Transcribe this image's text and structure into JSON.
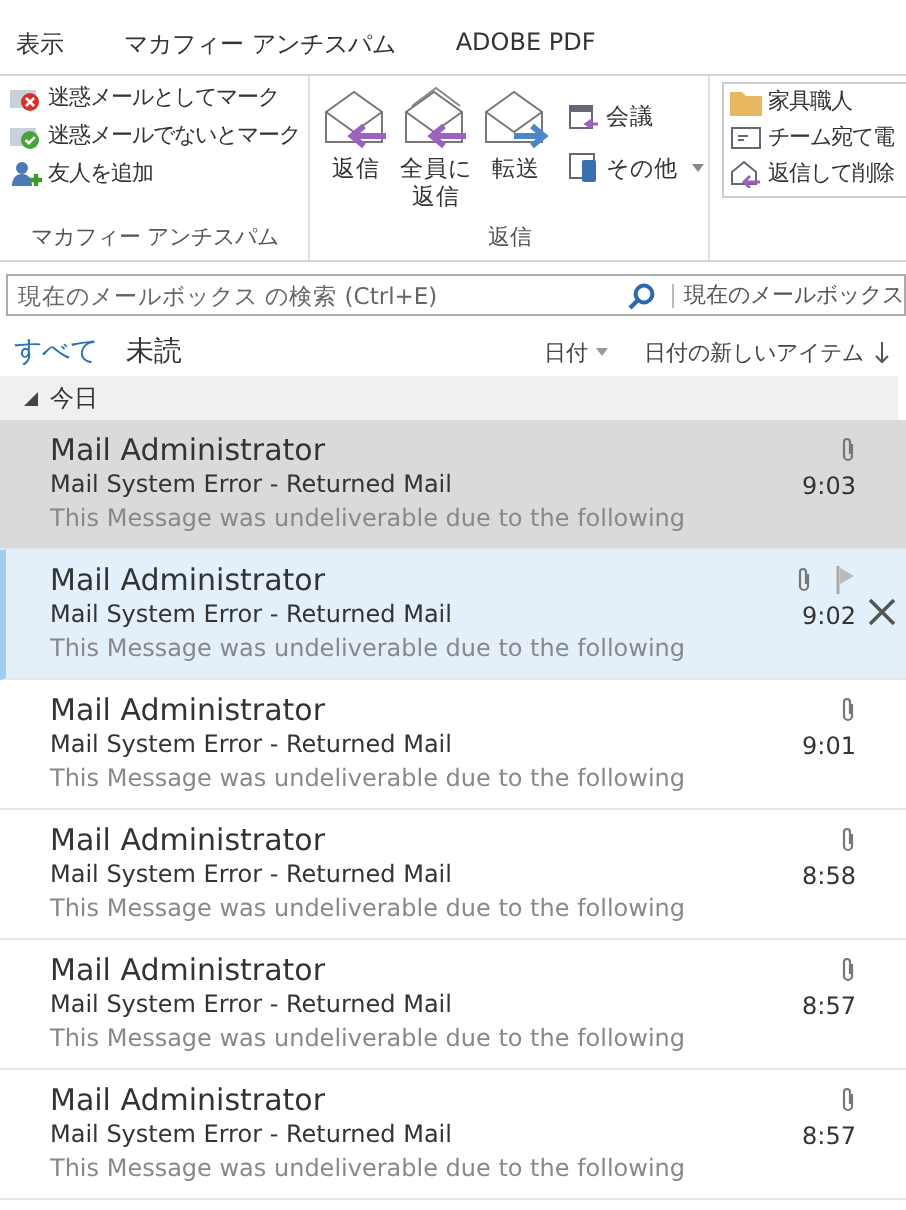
{
  "ribbon_tabs": [
    {
      "label": "表示"
    },
    {
      "label": "マカフィー アンチスパム"
    },
    {
      "label": "ADOBE PDF"
    }
  ],
  "ribbon": {
    "groups": [
      {
        "label": "マカフィー アンチスパム",
        "items": [
          {
            "kind": "spam",
            "label": "迷惑メールとしてマーク"
          },
          {
            "kind": "notspam",
            "label": "迷惑メールでないとマーク"
          },
          {
            "kind": "friend",
            "label": "友人を追加"
          }
        ]
      },
      {
        "label": "返信",
        "big": [
          {
            "kind": "reply",
            "label": "返信"
          },
          {
            "kind": "replyall",
            "label": "全員に返信"
          },
          {
            "kind": "forward",
            "label": "転送"
          }
        ],
        "small": [
          {
            "kind": "meeting",
            "label": "会議",
            "dropdown": false
          },
          {
            "kind": "more",
            "label": "その他",
            "dropdown": true
          }
        ]
      }
    ],
    "quick_steps": [
      {
        "kind": "folder",
        "label": "家具職人"
      },
      {
        "kind": "team",
        "label": "チーム宛て電"
      },
      {
        "kind": "replydelete",
        "label": "返信して削除"
      }
    ]
  },
  "search": {
    "placeholder": "現在のメールボックス の検索 (Ctrl+E)",
    "scope": "現在のメールボックス"
  },
  "filters": [
    {
      "label": "すべて",
      "selected": true
    },
    {
      "label": "未読",
      "selected": false
    }
  ],
  "sort": {
    "field": "日付",
    "order": "日付の新しいアイテム"
  },
  "group": {
    "label": "今日",
    "expanded": true
  },
  "messages": [
    {
      "sender": "Mail Administrator",
      "subject": "Mail System Error - Returned Mail",
      "preview": "This Message was undeliverable due to the following",
      "time": "9:03",
      "attachment": true,
      "selected": true,
      "hovered": false
    },
    {
      "sender": "Mail Administrator",
      "subject": "Mail System Error - Returned Mail",
      "preview": "This Message was undeliverable due to the following",
      "time": "9:02",
      "attachment": true,
      "selected": false,
      "hovered": true
    },
    {
      "sender": "Mail Administrator",
      "subject": "Mail System Error - Returned Mail",
      "preview": "This Message was undeliverable due to the following",
      "time": "9:01",
      "attachment": true,
      "selected": false,
      "hovered": false
    },
    {
      "sender": "Mail Administrator",
      "subject": "Mail System Error - Returned Mail",
      "preview": "This Message was undeliverable due to the following",
      "time": "8:58",
      "attachment": true,
      "selected": false,
      "hovered": false
    },
    {
      "sender": "Mail Administrator",
      "subject": "Mail System Error - Returned Mail",
      "preview": "This Message was undeliverable due to the following",
      "time": "8:57",
      "attachment": true,
      "selected": false,
      "hovered": false
    },
    {
      "sender": "Mail Administrator",
      "subject": "Mail System Error - Returned Mail",
      "preview": "This Message was undeliverable due to the following",
      "time": "8:57",
      "attachment": true,
      "selected": false,
      "hovered": false
    }
  ]
}
